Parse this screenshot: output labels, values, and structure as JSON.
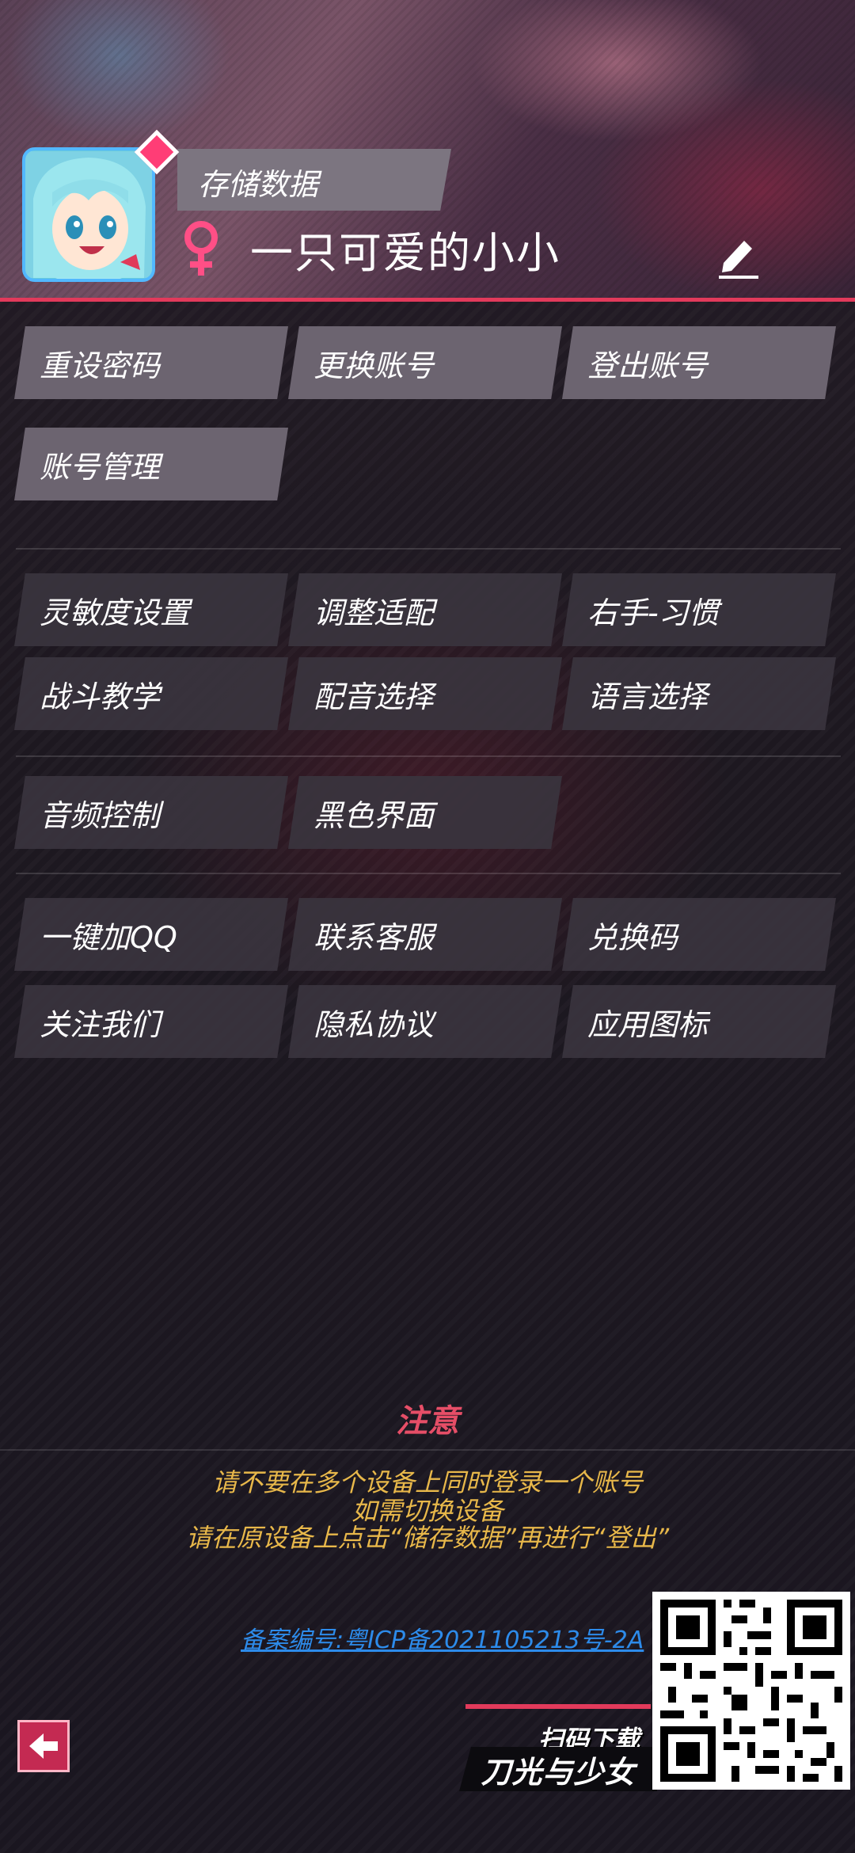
{
  "header": {
    "save_label": "存储数据",
    "username": "一只可爱的小小"
  },
  "account_buttons": [
    "重设密码",
    "更换账号",
    "登出账号",
    "账号管理"
  ],
  "settings_buttons": [
    "灵敏度设置",
    "调整适配",
    "右手-习惯",
    "战斗教学",
    "配音选择",
    "语言选择"
  ],
  "display_buttons": [
    "音频控制",
    "黑色界面"
  ],
  "service_buttons": [
    "一键加QQ",
    "联系客服",
    "兑换码",
    "关注我们",
    "隐私协议",
    "应用图标"
  ],
  "notice": {
    "title": "注意",
    "lines": [
      "请不要在多个设备上同时登录一个账号",
      "如需切换设备",
      "请在原设备上点击“储存数据”再进行“登出”"
    ]
  },
  "icp": "备案编号:粤ICP备2021105213号-2A",
  "download": {
    "scan_label": "扫码下载",
    "game_name": "刀光与少女"
  },
  "colors": {
    "accent": "#e23a5b",
    "notice_title": "#e64e67",
    "notice_text": "#e8b84a",
    "link": "#2d8bea"
  },
  "icons": [
    "female-icon",
    "edit-icon",
    "back-arrow-icon",
    "qr-code"
  ]
}
